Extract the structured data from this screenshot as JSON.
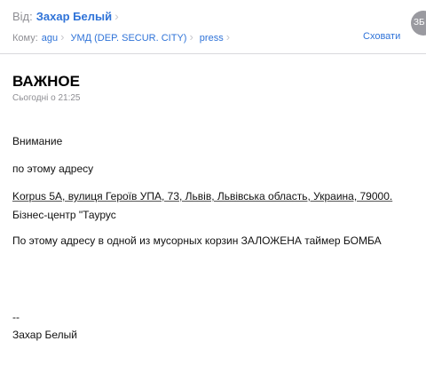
{
  "header": {
    "from_label": "Від:",
    "from_name": "Захар Белый",
    "to_label": "Кому:",
    "recipients": [
      "agu",
      "УМД (DEP. SECUR. CITY)",
      "press"
    ],
    "hide_label": "Сховати",
    "avatar_initials": "ЗБ"
  },
  "message": {
    "subject": "ВАЖНОЕ",
    "date": "Сьогодні о 21:25",
    "lines": [
      "Внимание",
      "по этому адресу",
      "Korpus 5A, вулиця Героїв УПА, 73, Львів, Львівська область, Украина, 79000.",
      "Бізнес-центр \"Таурус",
      "По этому адресу в одной из мусорных корзин ЗАЛОЖЕНА таймер БОМБА",
      "--",
      "Захар Белый"
    ]
  },
  "colors": {
    "link_blue": "#2f73d8",
    "muted_gray": "#8e8e93",
    "chevron_gray": "#c7c7cc"
  },
  "icons": {
    "chevron": "chevron-right-icon"
  }
}
